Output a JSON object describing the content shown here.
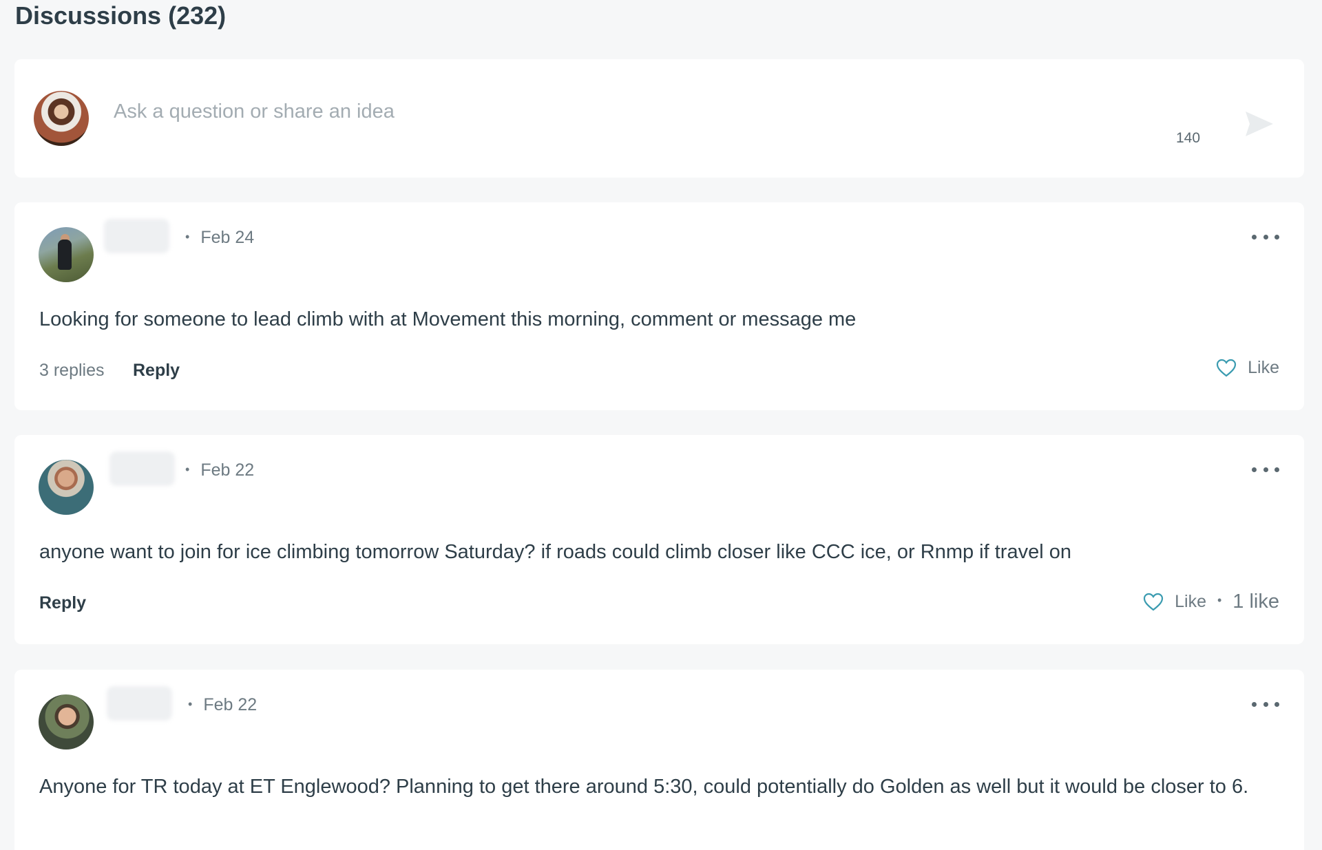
{
  "section": {
    "title": "Discussions (232)"
  },
  "composer": {
    "placeholder": "Ask a question or share an idea",
    "char_count": "140"
  },
  "posts": [
    {
      "date": "Feb 24",
      "body": "Looking for someone to lead climb with at Movement this morning, comment or message me",
      "replies": "3 replies",
      "reply_label": "Reply",
      "like_label": "Like",
      "likes": ""
    },
    {
      "date": "Feb 22",
      "body": "anyone want to join for ice climbing tomorrow Saturday? if roads could climb closer like CCC ice, or Rnmp if travel on",
      "replies": "",
      "reply_label": "Reply",
      "like_label": "Like",
      "likes": "1 like"
    },
    {
      "date": "Feb 22",
      "body": "Anyone for TR today at ET Englewood? Planning to get there around 5:30, could potentially do Golden as well but it would be closer to 6.",
      "replies": "",
      "reply_label": "",
      "like_label": "",
      "likes": ""
    }
  ],
  "colors": {
    "background": "#f6f7f8",
    "card": "#ffffff",
    "text": "#2e3e48",
    "muted": "#6d7a82",
    "like_icon": "#3a9bb0"
  },
  "icons": {
    "send": "send-icon",
    "more": "more-horizontal-icon",
    "like": "heart-icon"
  }
}
